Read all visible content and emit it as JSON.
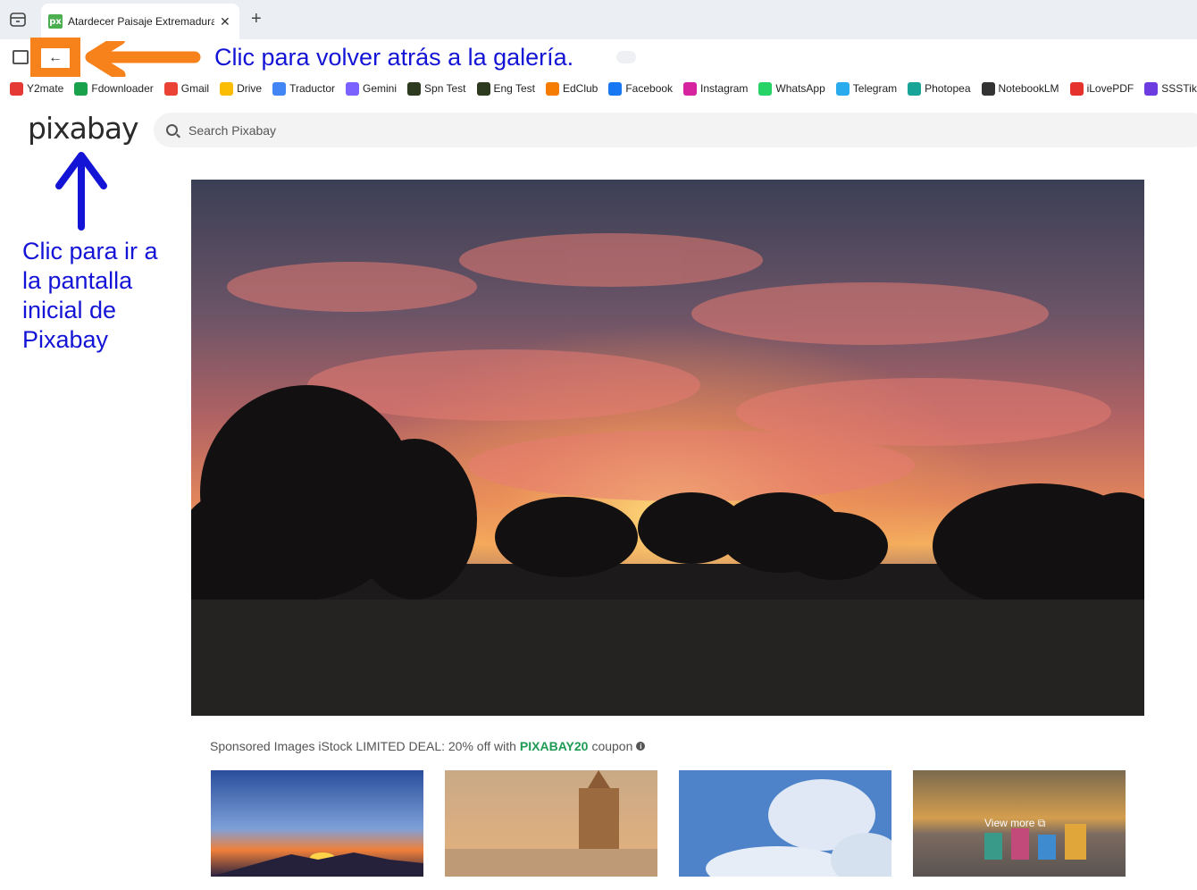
{
  "browser": {
    "tab_title": "Atardecer Paisaje Extremadura ·",
    "favicon_text": "px",
    "close_glyph": "✕",
    "new_tab_glyph": "+",
    "back_glyph": "←"
  },
  "bookmarks": [
    {
      "label": "Y2mate",
      "color": "#e53935"
    },
    {
      "label": "Fdownloader",
      "color": "#19a14b"
    },
    {
      "label": "Gmail",
      "color": "#ea4335"
    },
    {
      "label": "Drive",
      "color": "#fbbc04"
    },
    {
      "label": "Traductor",
      "color": "#4285f4"
    },
    {
      "label": "Gemini",
      "color": "#7b61ff"
    },
    {
      "label": "Spn Test",
      "color": "#2e3a1f"
    },
    {
      "label": "Eng Test",
      "color": "#2e3a1f"
    },
    {
      "label": "EdClub",
      "color": "#f57c00"
    },
    {
      "label": "Facebook",
      "color": "#1877f2"
    },
    {
      "label": "Instagram",
      "color": "#d6249f"
    },
    {
      "label": "WhatsApp",
      "color": "#25d366"
    },
    {
      "label": "Telegram",
      "color": "#2aabee"
    },
    {
      "label": "Photopea",
      "color": "#18a497"
    },
    {
      "label": "NotebookLM",
      "color": "#333333"
    },
    {
      "label": "iLovePDF",
      "color": "#e5322d"
    },
    {
      "label": "SSSTik",
      "color": "#6c3ce0"
    }
  ],
  "annotations": {
    "top": "Clic para volver atrás a la galería.",
    "left": "Clic para ir a la pantalla inicial de Pixabay",
    "top_color": "#f7821b",
    "left_color": "#1414d6"
  },
  "site": {
    "logo": "pixabay",
    "search_placeholder": "Search Pixabay"
  },
  "sponsored": {
    "prefix": "Sponsored Images iStock LIMITED DEAL: 20% off with",
    "code": "PIXABAY20",
    "suffix": "coupon",
    "info_glyph": "i",
    "view_more": "View more ⧉"
  }
}
